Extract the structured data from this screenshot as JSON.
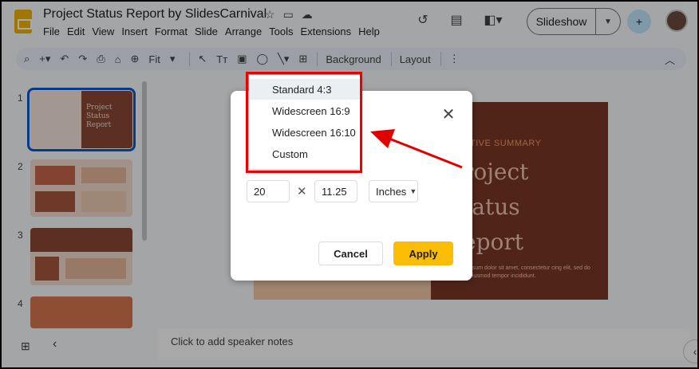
{
  "header": {
    "doc_title": "Project Status Report by SlidesCarnival",
    "menu": [
      "File",
      "Edit",
      "View",
      "Insert",
      "Format",
      "Slide",
      "Arrange",
      "Tools",
      "Extensions",
      "Help"
    ],
    "slideshow_label": "Slideshow"
  },
  "toolbar": {
    "zoom_label": "Fit",
    "background_label": "Background",
    "layout_label": "Layout"
  },
  "filmstrip": {
    "slides": [
      {
        "number": "1",
        "title": "Project Status Report"
      },
      {
        "number": "2"
      },
      {
        "number": "3"
      },
      {
        "number": "4"
      }
    ]
  },
  "slide": {
    "kicker": "CUTIVE SUMMARY",
    "title_lines": [
      "roject",
      "tatus",
      "eport"
    ],
    "body": "psum dolor sit amet, consectetur cing elit, sed do eiusmod tempor incididunt."
  },
  "notes_placeholder": "Click to add speaker notes",
  "page_setup_dialog": {
    "options": [
      "Standard 4:3",
      "Widescreen 16:9",
      "Widescreen 16:10",
      "Custom"
    ],
    "highlighted_option": "Standard 4:3",
    "width_value": "20",
    "height_value": "11.25",
    "units": "Inches",
    "cancel_label": "Cancel",
    "apply_label": "Apply"
  },
  "colors": {
    "apply_button": "#fbbc04",
    "annotation_red": "#e00000",
    "slide_brown": "#7a3826",
    "selection_blue": "#0b57d0"
  }
}
